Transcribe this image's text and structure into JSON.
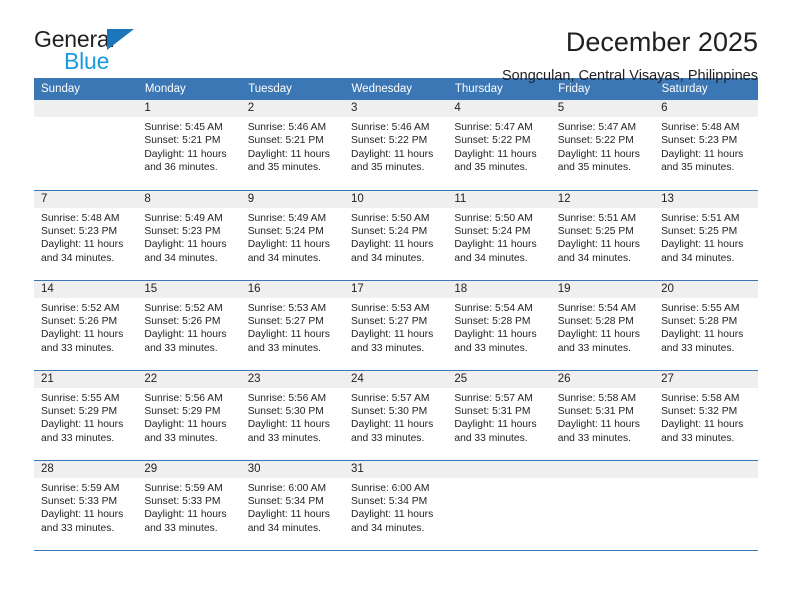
{
  "logo": {
    "word_one": "General",
    "word_two": "Blue",
    "triangle_color": "#1b75bb",
    "blue_text_color": "#1b9ae0"
  },
  "header": {
    "title": "December 2025",
    "subtitle": "Songculan, Central Visayas, Philippines"
  },
  "colors": {
    "header_bar": "#3c77b5",
    "daynum_band": "#efeff0",
    "text": "#231f20",
    "week_separator": "#3c77b5"
  },
  "calendar": {
    "weekday_headers": [
      "Sunday",
      "Monday",
      "Tuesday",
      "Wednesday",
      "Thursday",
      "Friday",
      "Saturday"
    ],
    "weeks": [
      [
        {
          "day": "",
          "sunrise": "",
          "sunset": "",
          "daylight_line1": "",
          "daylight_line2": ""
        },
        {
          "day": "1",
          "sunrise": "Sunrise: 5:45 AM",
          "sunset": "Sunset: 5:21 PM",
          "daylight_line1": "Daylight: 11 hours",
          "daylight_line2": "and 36 minutes."
        },
        {
          "day": "2",
          "sunrise": "Sunrise: 5:46 AM",
          "sunset": "Sunset: 5:21 PM",
          "daylight_line1": "Daylight: 11 hours",
          "daylight_line2": "and 35 minutes."
        },
        {
          "day": "3",
          "sunrise": "Sunrise: 5:46 AM",
          "sunset": "Sunset: 5:22 PM",
          "daylight_line1": "Daylight: 11 hours",
          "daylight_line2": "and 35 minutes."
        },
        {
          "day": "4",
          "sunrise": "Sunrise: 5:47 AM",
          "sunset": "Sunset: 5:22 PM",
          "daylight_line1": "Daylight: 11 hours",
          "daylight_line2": "and 35 minutes."
        },
        {
          "day": "5",
          "sunrise": "Sunrise: 5:47 AM",
          "sunset": "Sunset: 5:22 PM",
          "daylight_line1": "Daylight: 11 hours",
          "daylight_line2": "and 35 minutes."
        },
        {
          "day": "6",
          "sunrise": "Sunrise: 5:48 AM",
          "sunset": "Sunset: 5:23 PM",
          "daylight_line1": "Daylight: 11 hours",
          "daylight_line2": "and 35 minutes."
        }
      ],
      [
        {
          "day": "7",
          "sunrise": "Sunrise: 5:48 AM",
          "sunset": "Sunset: 5:23 PM",
          "daylight_line1": "Daylight: 11 hours",
          "daylight_line2": "and 34 minutes."
        },
        {
          "day": "8",
          "sunrise": "Sunrise: 5:49 AM",
          "sunset": "Sunset: 5:23 PM",
          "daylight_line1": "Daylight: 11 hours",
          "daylight_line2": "and 34 minutes."
        },
        {
          "day": "9",
          "sunrise": "Sunrise: 5:49 AM",
          "sunset": "Sunset: 5:24 PM",
          "daylight_line1": "Daylight: 11 hours",
          "daylight_line2": "and 34 minutes."
        },
        {
          "day": "10",
          "sunrise": "Sunrise: 5:50 AM",
          "sunset": "Sunset: 5:24 PM",
          "daylight_line1": "Daylight: 11 hours",
          "daylight_line2": "and 34 minutes."
        },
        {
          "day": "11",
          "sunrise": "Sunrise: 5:50 AM",
          "sunset": "Sunset: 5:24 PM",
          "daylight_line1": "Daylight: 11 hours",
          "daylight_line2": "and 34 minutes."
        },
        {
          "day": "12",
          "sunrise": "Sunrise: 5:51 AM",
          "sunset": "Sunset: 5:25 PM",
          "daylight_line1": "Daylight: 11 hours",
          "daylight_line2": "and 34 minutes."
        },
        {
          "day": "13",
          "sunrise": "Sunrise: 5:51 AM",
          "sunset": "Sunset: 5:25 PM",
          "daylight_line1": "Daylight: 11 hours",
          "daylight_line2": "and 34 minutes."
        }
      ],
      [
        {
          "day": "14",
          "sunrise": "Sunrise: 5:52 AM",
          "sunset": "Sunset: 5:26 PM",
          "daylight_line1": "Daylight: 11 hours",
          "daylight_line2": "and 33 minutes."
        },
        {
          "day": "15",
          "sunrise": "Sunrise: 5:52 AM",
          "sunset": "Sunset: 5:26 PM",
          "daylight_line1": "Daylight: 11 hours",
          "daylight_line2": "and 33 minutes."
        },
        {
          "day": "16",
          "sunrise": "Sunrise: 5:53 AM",
          "sunset": "Sunset: 5:27 PM",
          "daylight_line1": "Daylight: 11 hours",
          "daylight_line2": "and 33 minutes."
        },
        {
          "day": "17",
          "sunrise": "Sunrise: 5:53 AM",
          "sunset": "Sunset: 5:27 PM",
          "daylight_line1": "Daylight: 11 hours",
          "daylight_line2": "and 33 minutes."
        },
        {
          "day": "18",
          "sunrise": "Sunrise: 5:54 AM",
          "sunset": "Sunset: 5:28 PM",
          "daylight_line1": "Daylight: 11 hours",
          "daylight_line2": "and 33 minutes."
        },
        {
          "day": "19",
          "sunrise": "Sunrise: 5:54 AM",
          "sunset": "Sunset: 5:28 PM",
          "daylight_line1": "Daylight: 11 hours",
          "daylight_line2": "and 33 minutes."
        },
        {
          "day": "20",
          "sunrise": "Sunrise: 5:55 AM",
          "sunset": "Sunset: 5:28 PM",
          "daylight_line1": "Daylight: 11 hours",
          "daylight_line2": "and 33 minutes."
        }
      ],
      [
        {
          "day": "21",
          "sunrise": "Sunrise: 5:55 AM",
          "sunset": "Sunset: 5:29 PM",
          "daylight_line1": "Daylight: 11 hours",
          "daylight_line2": "and 33 minutes."
        },
        {
          "day": "22",
          "sunrise": "Sunrise: 5:56 AM",
          "sunset": "Sunset: 5:29 PM",
          "daylight_line1": "Daylight: 11 hours",
          "daylight_line2": "and 33 minutes."
        },
        {
          "day": "23",
          "sunrise": "Sunrise: 5:56 AM",
          "sunset": "Sunset: 5:30 PM",
          "daylight_line1": "Daylight: 11 hours",
          "daylight_line2": "and 33 minutes."
        },
        {
          "day": "24",
          "sunrise": "Sunrise: 5:57 AM",
          "sunset": "Sunset: 5:30 PM",
          "daylight_line1": "Daylight: 11 hours",
          "daylight_line2": "and 33 minutes."
        },
        {
          "day": "25",
          "sunrise": "Sunrise: 5:57 AM",
          "sunset": "Sunset: 5:31 PM",
          "daylight_line1": "Daylight: 11 hours",
          "daylight_line2": "and 33 minutes."
        },
        {
          "day": "26",
          "sunrise": "Sunrise: 5:58 AM",
          "sunset": "Sunset: 5:31 PM",
          "daylight_line1": "Daylight: 11 hours",
          "daylight_line2": "and 33 minutes."
        },
        {
          "day": "27",
          "sunrise": "Sunrise: 5:58 AM",
          "sunset": "Sunset: 5:32 PM",
          "daylight_line1": "Daylight: 11 hours",
          "daylight_line2": "and 33 minutes."
        }
      ],
      [
        {
          "day": "28",
          "sunrise": "Sunrise: 5:59 AM",
          "sunset": "Sunset: 5:33 PM",
          "daylight_line1": "Daylight: 11 hours",
          "daylight_line2": "and 33 minutes."
        },
        {
          "day": "29",
          "sunrise": "Sunrise: 5:59 AM",
          "sunset": "Sunset: 5:33 PM",
          "daylight_line1": "Daylight: 11 hours",
          "daylight_line2": "and 33 minutes."
        },
        {
          "day": "30",
          "sunrise": "Sunrise: 6:00 AM",
          "sunset": "Sunset: 5:34 PM",
          "daylight_line1": "Daylight: 11 hours",
          "daylight_line2": "and 34 minutes."
        },
        {
          "day": "31",
          "sunrise": "Sunrise: 6:00 AM",
          "sunset": "Sunset: 5:34 PM",
          "daylight_line1": "Daylight: 11 hours",
          "daylight_line2": "and 34 minutes."
        },
        {
          "day": "",
          "sunrise": "",
          "sunset": "",
          "daylight_line1": "",
          "daylight_line2": ""
        },
        {
          "day": "",
          "sunrise": "",
          "sunset": "",
          "daylight_line1": "",
          "daylight_line2": ""
        },
        {
          "day": "",
          "sunrise": "",
          "sunset": "",
          "daylight_line1": "",
          "daylight_line2": ""
        }
      ]
    ]
  }
}
